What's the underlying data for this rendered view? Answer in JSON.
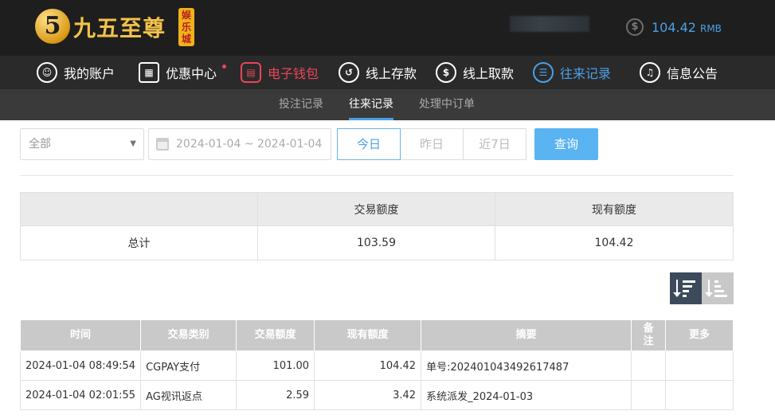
{
  "brand": {
    "logo_mark": "5",
    "name": "九五至尊",
    "badge": "娱乐城"
  },
  "account": {
    "balance": "104.42",
    "unit": "RMB",
    "icon": "dollar-coin-icon"
  },
  "nav": [
    {
      "label": "我的账户",
      "icon": "user-icon"
    },
    {
      "label": "优惠中心",
      "icon": "gift-icon"
    },
    {
      "label": "电子钱包",
      "icon": "wallet-icon"
    },
    {
      "label": "线上存款",
      "icon": "deposit-icon"
    },
    {
      "label": "线上取款",
      "icon": "withdraw-icon"
    },
    {
      "label": "往来记录",
      "icon": "records-icon"
    },
    {
      "label": "信息公告",
      "icon": "bell-icon"
    }
  ],
  "subnav": [
    "投注记录",
    "往来记录",
    "处理中订单"
  ],
  "filter": {
    "type_selected": "全部",
    "date_range": "2024-01-04 ~ 2024-01-04",
    "quick_ranges": [
      "今日",
      "昨日",
      "近7日"
    ],
    "query_label": "查询"
  },
  "summary": {
    "headers": [
      "",
      "交易额度",
      "现有额度"
    ],
    "row": [
      "总计",
      "103.59",
      "104.42"
    ]
  },
  "records": {
    "headers": [
      "时间",
      "交易类别",
      "交易额度",
      "现有额度",
      "摘要",
      "备注",
      "更多"
    ],
    "rows": [
      [
        "2024-01-04 08:49:54",
        "CGPAY支付",
        "101.00",
        "104.42",
        "单号:202401043492617487",
        "",
        ""
      ],
      [
        "2024-01-04 02:01:55",
        "AG视讯返点",
        "2.59",
        "3.42",
        "系统派发_2024-01-03",
        "",
        ""
      ]
    ]
  },
  "colors": {
    "accent": "#4ba0e6",
    "alert": "#e8465a",
    "gold": "#f4c24a"
  }
}
